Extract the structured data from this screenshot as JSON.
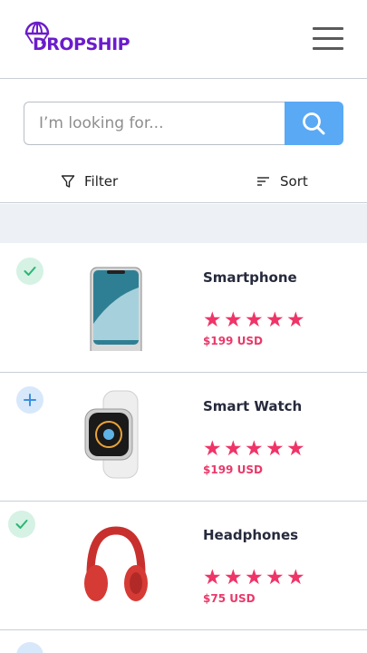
{
  "app": {
    "logo_text": "DROPSHIP"
  },
  "search": {
    "placeholder": "I’m looking for..."
  },
  "toolbar": {
    "filter_label": "Filter",
    "sort_label": "Sort"
  },
  "products": [
    {
      "name": "Smartphone",
      "price": "$199 USD",
      "rating": 5,
      "status": "added",
      "image": "smartphone-image"
    },
    {
      "name": "Smart Watch",
      "price": "$199 USD",
      "rating": 5,
      "status": "not-added",
      "image": "smartwatch-image"
    },
    {
      "name": "Headphones",
      "price": "$75 USD",
      "rating": 5,
      "status": "added",
      "image": "headphones-image"
    }
  ],
  "colors": {
    "brand": "#6b1ccb",
    "accent": "#5aa9f5",
    "star": "#ef3468",
    "price": "#e83a6a",
    "check_bg": "#d5f2e4",
    "add_bg": "#d7e8fa"
  }
}
